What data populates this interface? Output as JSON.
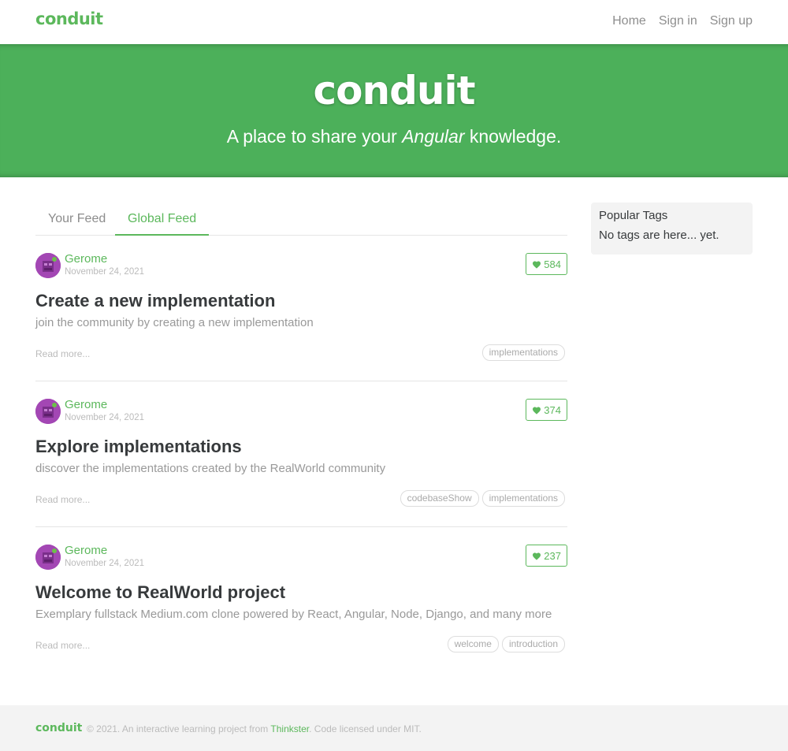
{
  "navbar": {
    "brand": "conduit",
    "links": [
      "Home",
      "Sign in",
      "Sign up"
    ]
  },
  "banner": {
    "title": "conduit",
    "subtitle_before": "A place to share your ",
    "subtitle_em": "Angular",
    "subtitle_after": " knowledge."
  },
  "feed": {
    "tabs": [
      "Your Feed",
      "Global Feed"
    ],
    "active_tab": "Global Feed",
    "articles": [
      {
        "author": "Gerome",
        "date": "November 24, 2021",
        "likes": "584",
        "title": "Create a new implementation",
        "description": "join the community by creating a new implementation",
        "read_more": "Read more...",
        "tags": [
          "implementations"
        ]
      },
      {
        "author": "Gerome",
        "date": "November 24, 2021",
        "likes": "374",
        "title": "Explore implementations",
        "description": "discover the implementations created by the RealWorld community",
        "read_more": "Read more...",
        "tags": [
          "codebaseShow",
          "implementations"
        ]
      },
      {
        "author": "Gerome",
        "date": "November 24, 2021",
        "likes": "237",
        "title": "Welcome to RealWorld project",
        "description": "Exemplary fullstack Medium.com clone powered by React, Angular, Node, Django, and many more",
        "read_more": "Read more...",
        "tags": [
          "welcome",
          "introduction"
        ]
      }
    ]
  },
  "sidebar": {
    "title": "Popular Tags",
    "empty_text": "No tags are here... yet."
  },
  "footer": {
    "brand": "conduit",
    "text_before": "© 2021. An interactive learning project from ",
    "link": "Thinkster",
    "text_after": ". Code licensed under MIT."
  },
  "colors": {
    "brand": "#5cb85c",
    "banner": "#4cb05a",
    "avatar": "#a347b4"
  },
  "icons": {
    "like": "heart-icon",
    "avatar": "avatar-image"
  }
}
